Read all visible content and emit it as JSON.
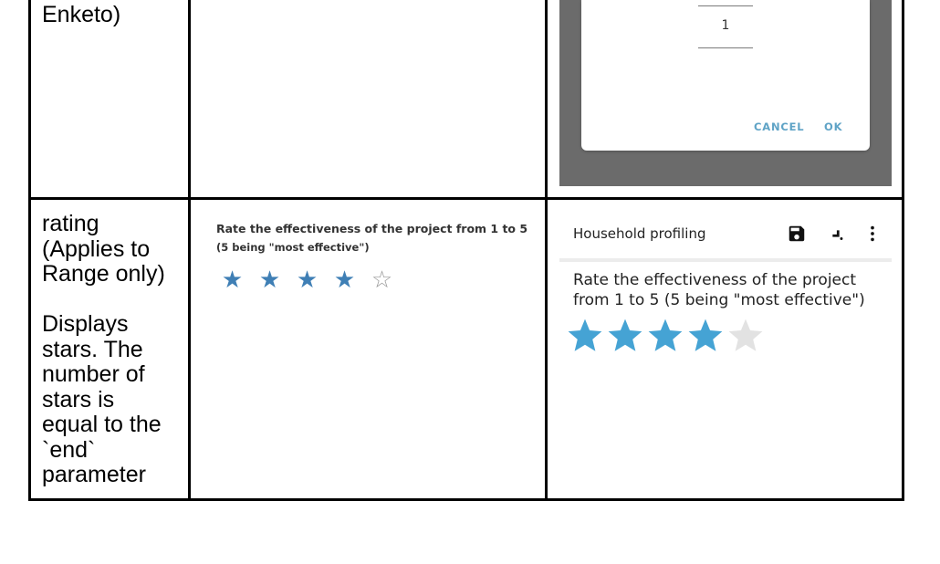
{
  "row1": {
    "col1_tail": "Enketo)",
    "dialog": {
      "picker_value": "1",
      "cancel_label": "CANCEL",
      "ok_label": "OK"
    }
  },
  "row2": {
    "col1": {
      "line1": "rating",
      "line2": "(Applies to",
      "line3": "Range only)",
      "desc1": "Displays",
      "desc2": "stars. The",
      "desc3": "number of",
      "desc4": "stars is",
      "desc5": "equal to the",
      "desc6": "`end`",
      "desc7": "parameter"
    },
    "enketo": {
      "label_line1": "Rate the effectiveness of the project from 1 to 5",
      "label_line2": "(5 being \"most effective\")",
      "rating_value": 4,
      "rating_max": 5,
      "filled_color": "#3f7fb5",
      "empty_color": "#9a9a9a",
      "filled_glyph": "★",
      "empty_glyph": "☆"
    },
    "collect": {
      "header_title": "Household profiling",
      "header_icons": [
        "save-icon",
        "go-to-arrow-icon",
        "more-vertical-icon"
      ],
      "question_line1": "Rate the effectiveness of the project",
      "question_line2": "from 1 to 5 (5 being \"most effective\")",
      "rating_value": 4,
      "rating_max": 5,
      "filled_color": "#45a3d4",
      "empty_color": "#e2e2e2"
    }
  }
}
